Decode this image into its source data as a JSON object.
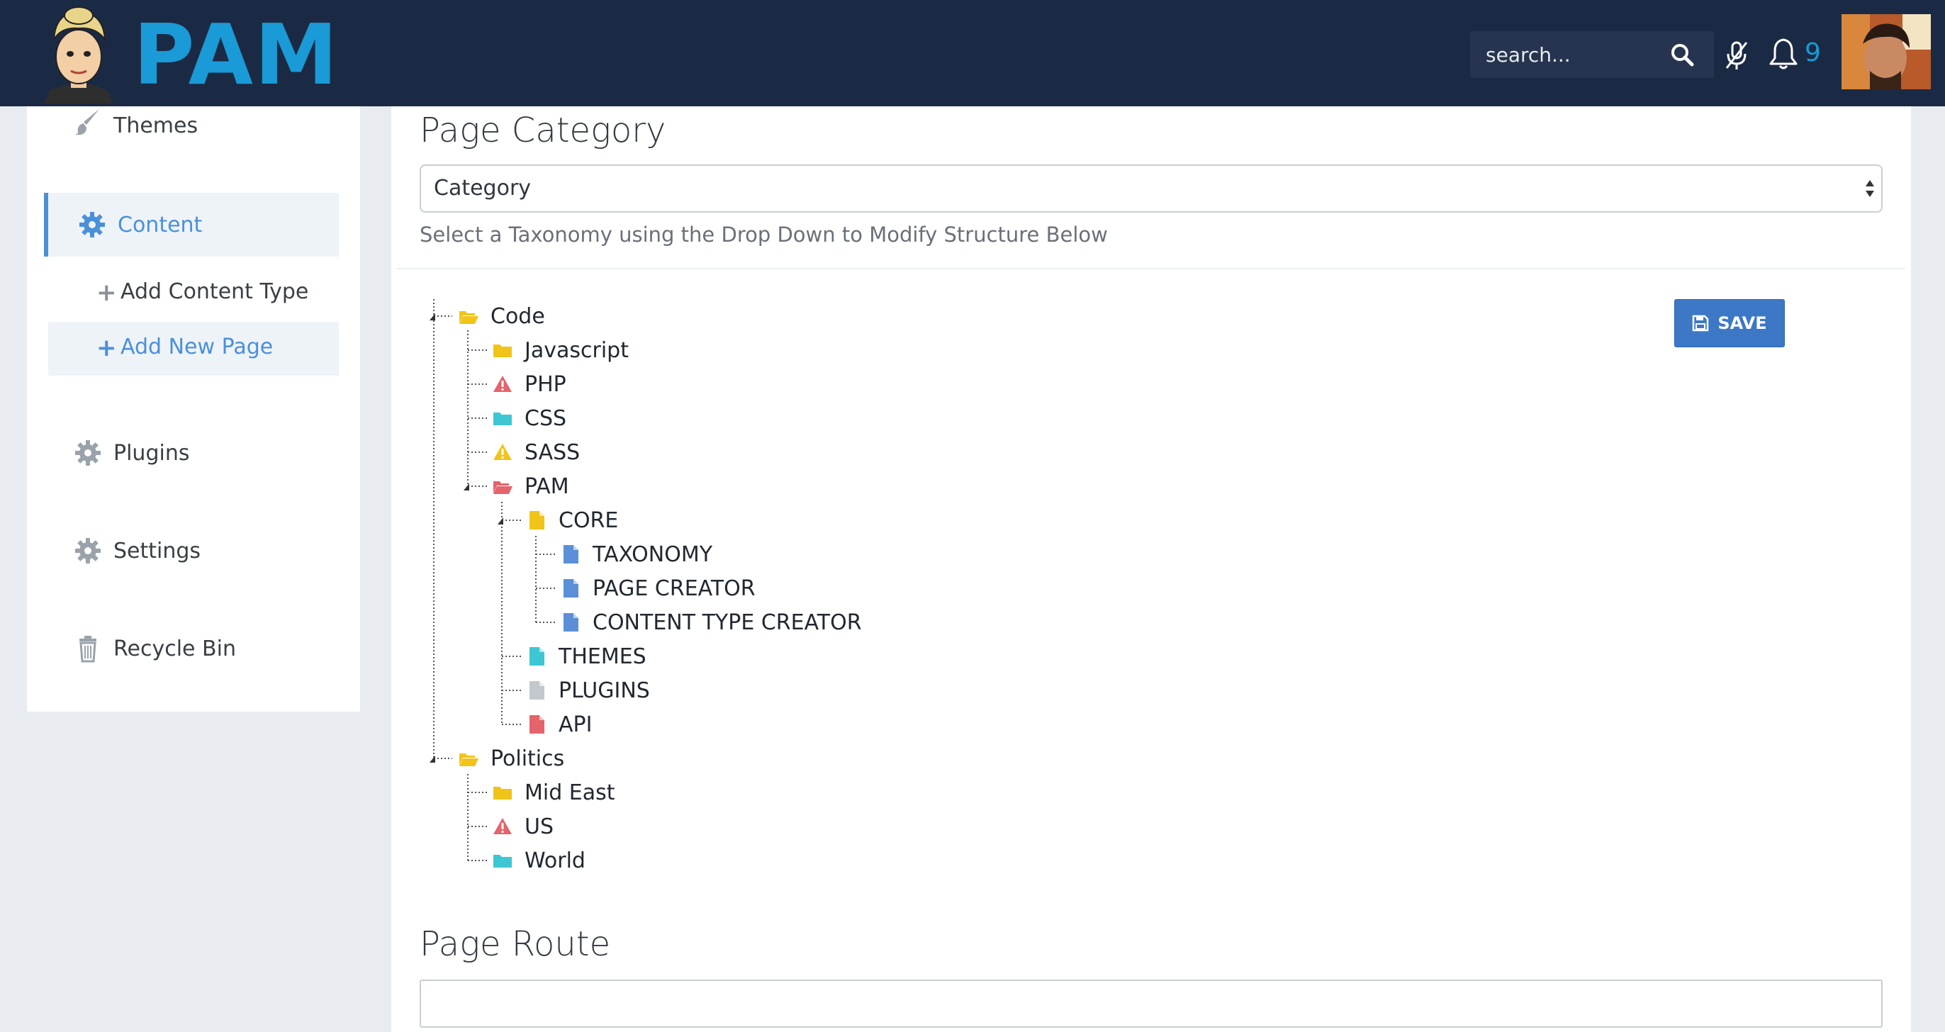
{
  "header": {
    "brand": "PAM",
    "search_placeholder": "search...",
    "notification_count": "9",
    "colors": {
      "bar": "#1b2a44",
      "accent": "#1a9ad6"
    }
  },
  "sidebar": {
    "items": [
      {
        "label": "Themes",
        "icon": "brush-icon"
      },
      {
        "label": "Content",
        "icon": "gear-icon",
        "active": true
      },
      {
        "label": "Add Content Type",
        "icon": "plus-icon"
      },
      {
        "label": "Add New Page",
        "icon": "plus-icon",
        "selected": true
      },
      {
        "label": "Plugins",
        "icon": "gear-icon"
      },
      {
        "label": "Settings",
        "icon": "gear-icon"
      },
      {
        "label": "Recycle Bin",
        "icon": "trash-icon"
      }
    ]
  },
  "main": {
    "category_heading": "Page Category",
    "category_select_value": "Category",
    "help_text": "Select a Taxonomy using the Drop Down to Modify Structure Below",
    "save_label": "SAVE",
    "route_heading": "Page Route"
  },
  "tree": {
    "nodes": [
      {
        "label": "Code",
        "icon": "folder-open-icon",
        "color": "#f0c419"
      },
      {
        "label": "Javascript",
        "icon": "folder-icon",
        "color": "#f0c419"
      },
      {
        "label": "PHP",
        "icon": "warning-icon",
        "color": "#e5636b"
      },
      {
        "label": "CSS",
        "icon": "folder-icon",
        "color": "#3fc6d3"
      },
      {
        "label": "SASS",
        "icon": "warning-icon",
        "color": "#f0c419"
      },
      {
        "label": "PAM",
        "icon": "folder-open-icon",
        "color": "#e5636b"
      },
      {
        "label": "CORE",
        "icon": "file-icon",
        "color": "#f0c419"
      },
      {
        "label": "TAXONOMY",
        "icon": "file-icon",
        "color": "#5b8fd8"
      },
      {
        "label": "PAGE CREATOR",
        "icon": "file-icon",
        "color": "#5b8fd8"
      },
      {
        "label": "CONTENT TYPE CREATOR",
        "icon": "file-icon",
        "color": "#5b8fd8"
      },
      {
        "label": "THEMES",
        "icon": "file-icon",
        "color": "#3fc6d3"
      },
      {
        "label": "PLUGINS",
        "icon": "file-icon",
        "color": "#c3c8ce"
      },
      {
        "label": "API",
        "icon": "file-icon",
        "color": "#e5636b"
      },
      {
        "label": "Politics",
        "icon": "folder-open-icon",
        "color": "#f0c419"
      },
      {
        "label": "Mid East",
        "icon": "folder-icon",
        "color": "#f0c419"
      },
      {
        "label": "US",
        "icon": "warning-icon",
        "color": "#e5636b"
      },
      {
        "label": "World",
        "icon": "folder-icon",
        "color": "#3fc6d3"
      }
    ]
  }
}
